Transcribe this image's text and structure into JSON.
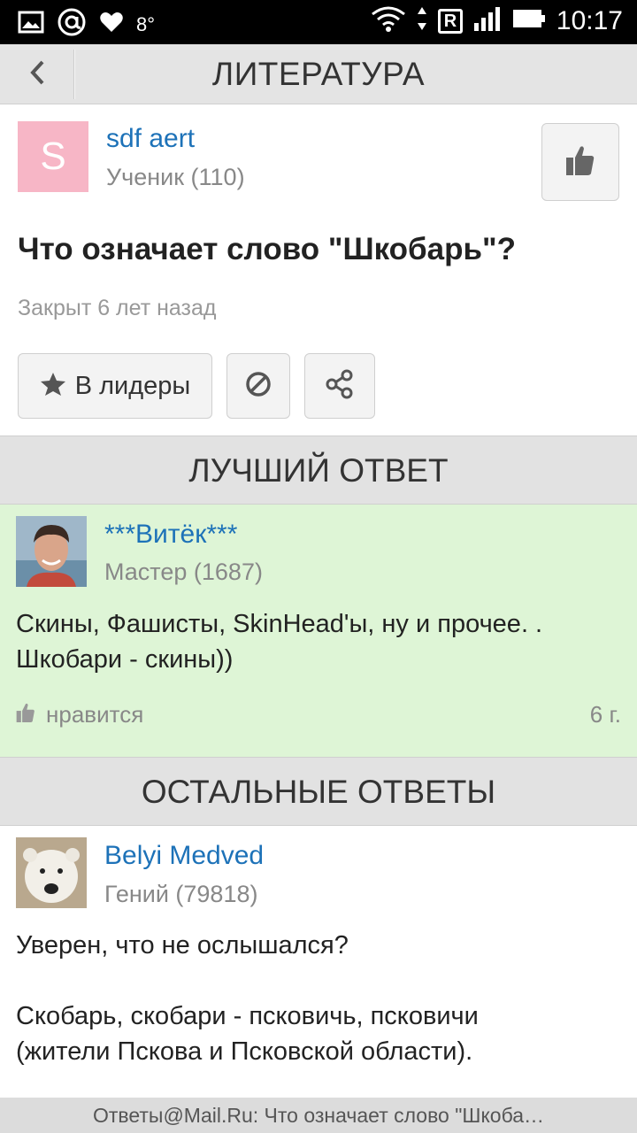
{
  "status_bar": {
    "temperature": "8°",
    "time": "10:17",
    "carrier_badge": "R"
  },
  "header": {
    "title": "ЛИТЕРАТУРА"
  },
  "question": {
    "author": {
      "avatar_letter": "S",
      "name": "sdf aert",
      "rank": "Ученик (110)"
    },
    "title": "Что означает слово \"Шкобарь\"?",
    "status": "Закрыт 6 лет назад",
    "leaders_button_label": "В лидеры"
  },
  "sections": {
    "best_answer": "ЛУЧШИЙ ОТВЕТ",
    "other_answers": "ОСТАЛЬНЫЕ ОТВЕТЫ"
  },
  "best_answer": {
    "author_name": "***Витёк***",
    "author_rank": "Мастер (1687)",
    "text_line1": "Скины, Фашисты, SkinHead'ы, ну и прочее. .",
    "text_line2": "Шкобари - скины))",
    "like_label": "нравится",
    "age": "6 г."
  },
  "other_answer": {
    "author_name": "Belyi Medved",
    "author_rank": "Гений (79818)",
    "text_line1": "Уверен, что не ослышался?",
    "text_line2": "Скобарь, скобари - псковичь, псковичи",
    "text_line3": "(жители Пскова и Псковской области)."
  },
  "bottom_bar": {
    "text": "Ответы@Mail.Ru: Что означает слово \"Шкоба…"
  },
  "colors": {
    "link_blue": "#1d72b8",
    "best_bg": "#def5d6",
    "avatar_pink": "#f7b6c6"
  }
}
